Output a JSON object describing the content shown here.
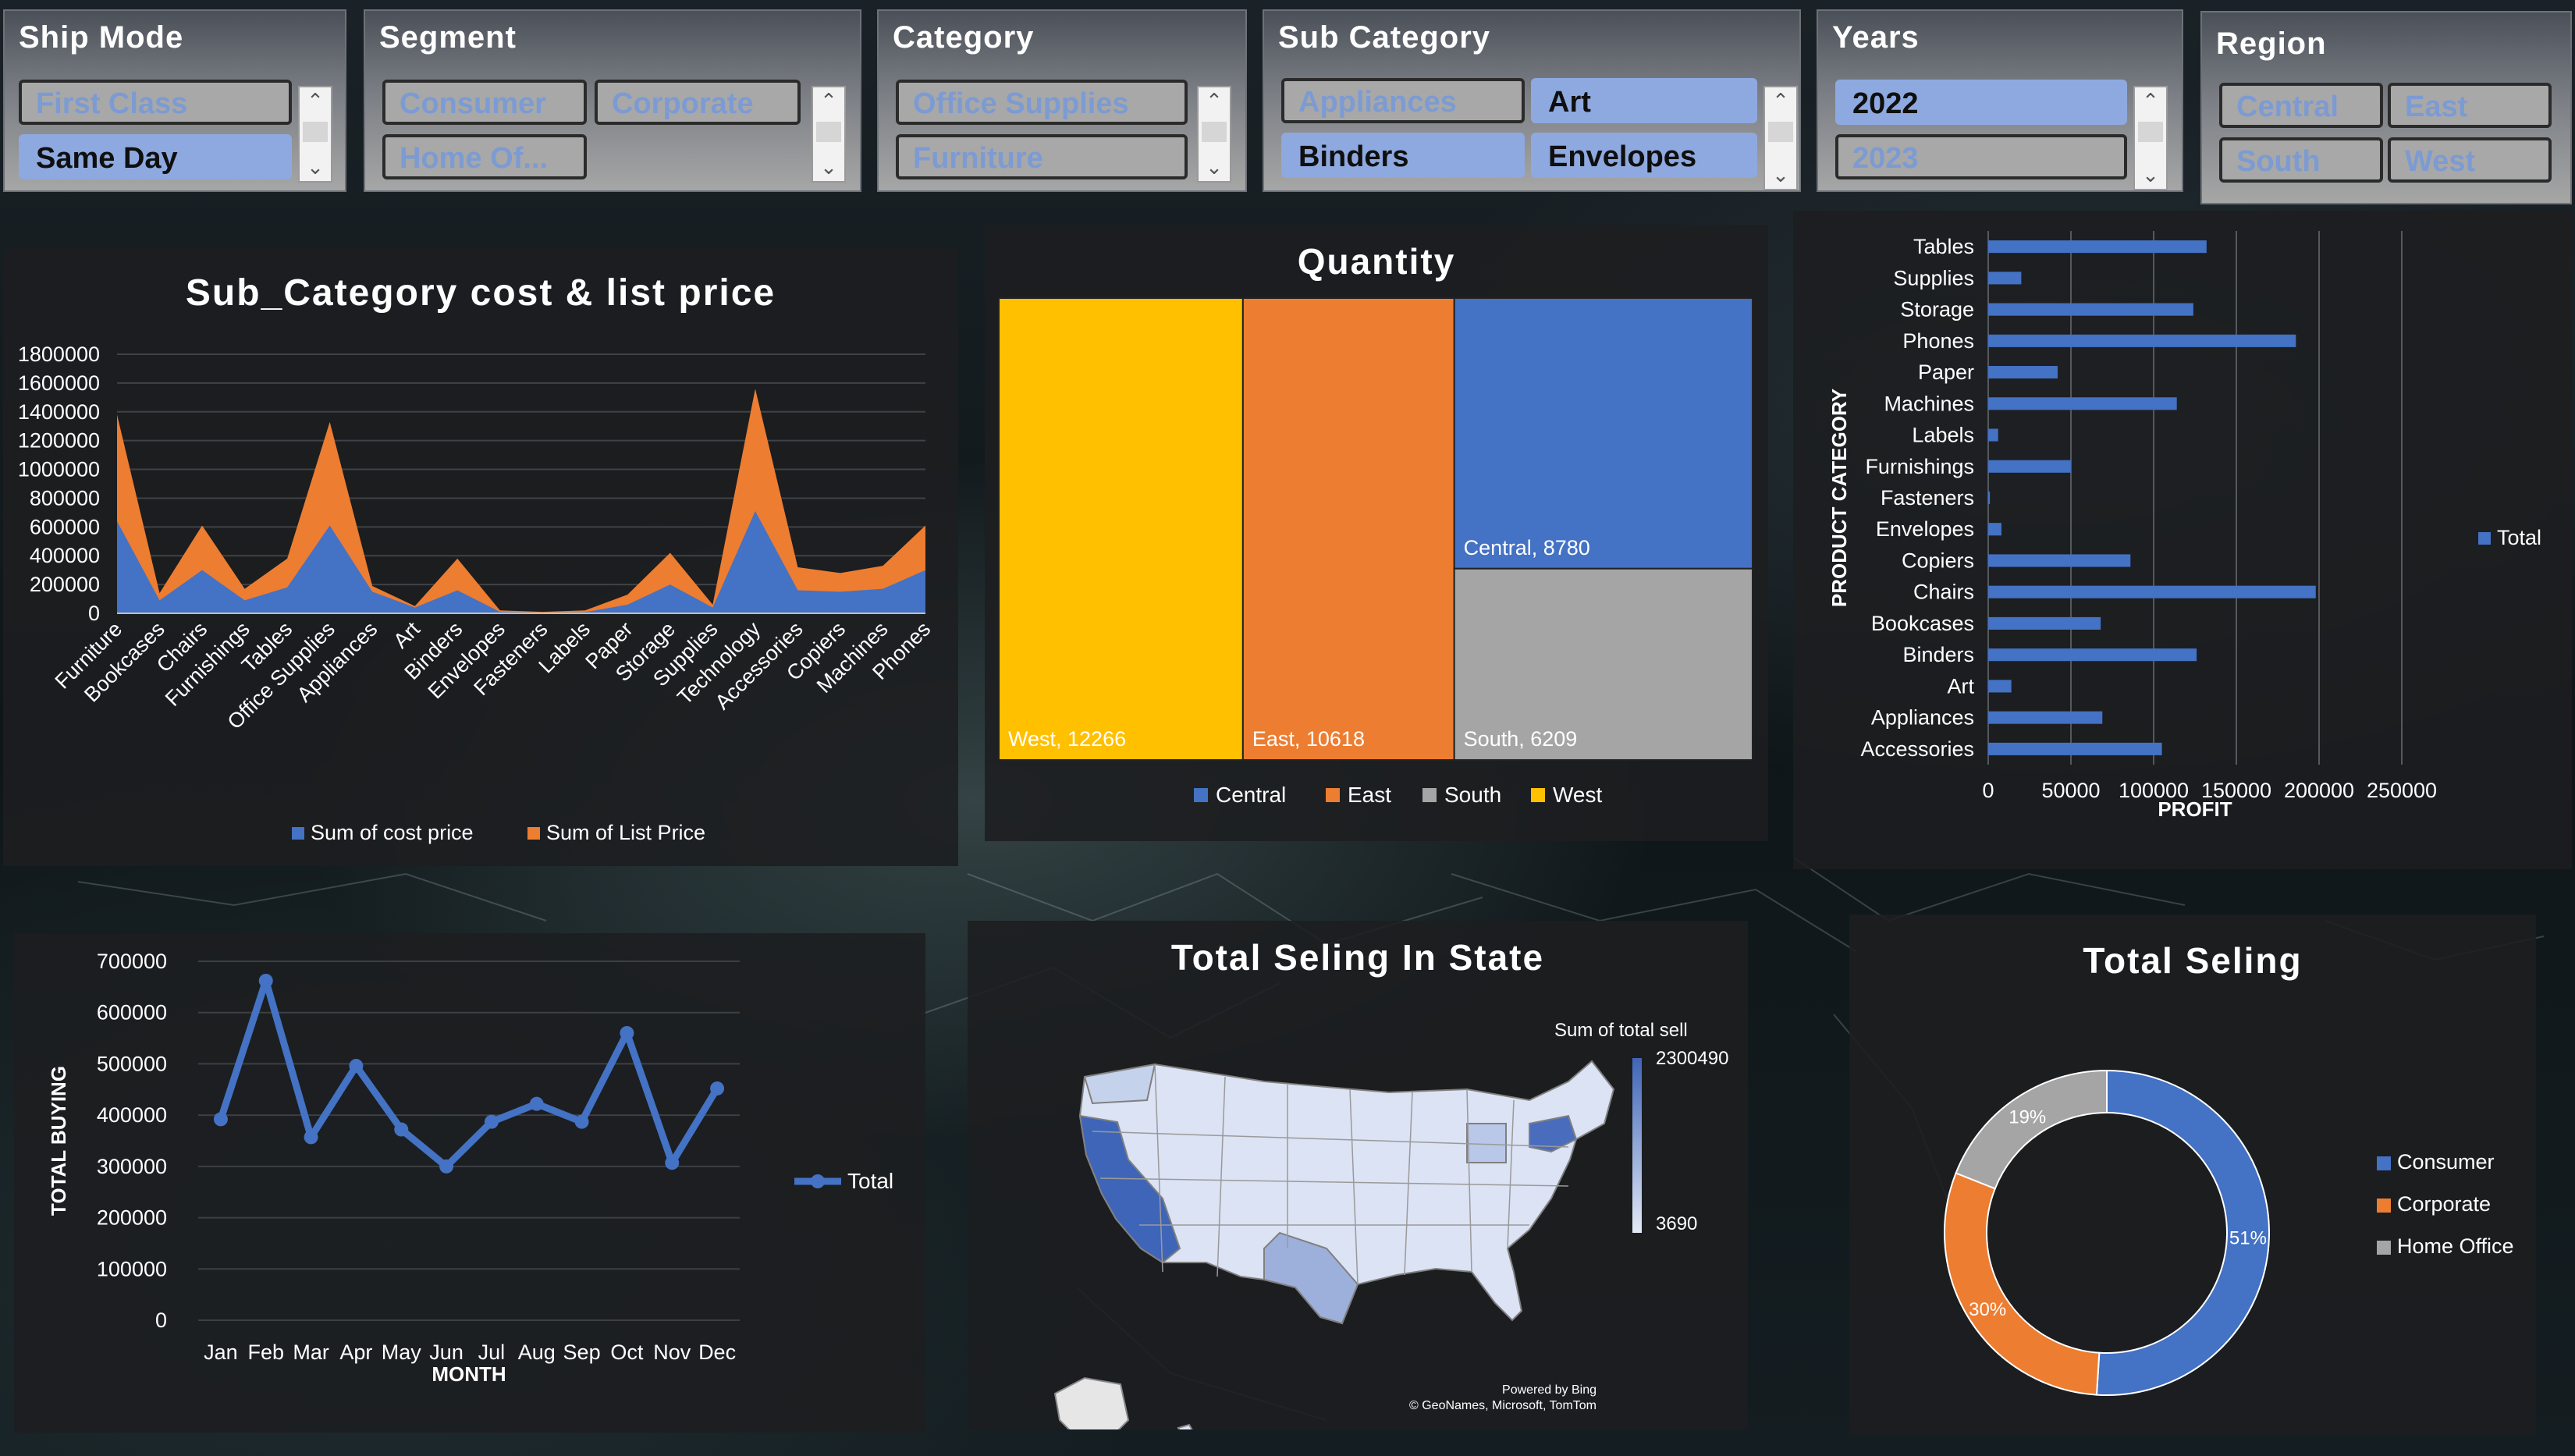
{
  "slicers": {
    "ship_mode": {
      "title": "Ship Mode",
      "items": [
        {
          "label": "First Class",
          "selected": false
        },
        {
          "label": "Same Day",
          "selected": true
        }
      ]
    },
    "segment": {
      "title": "Segment",
      "items": [
        {
          "label": "Consumer",
          "selected": false
        },
        {
          "label": "Corporate",
          "selected": false
        },
        {
          "label": "Home Of...",
          "selected": false
        }
      ]
    },
    "category": {
      "title": "Category",
      "items": [
        {
          "label": "Office Supplies",
          "selected": false
        },
        {
          "label": "Furniture",
          "selected": false
        }
      ]
    },
    "sub_category": {
      "title": "Sub Category",
      "items": [
        {
          "label": "Appliances",
          "selected": false
        },
        {
          "label": "Art",
          "selected": true
        },
        {
          "label": "Binders",
          "selected": true
        },
        {
          "label": "Envelopes",
          "selected": true
        }
      ]
    },
    "years": {
      "title": "Years",
      "items": [
        {
          "label": "2022",
          "selected": true
        },
        {
          "label": "2023",
          "selected": false
        }
      ]
    },
    "region": {
      "title": "Region",
      "items": [
        {
          "label": "Central",
          "selected": false
        },
        {
          "label": "East",
          "selected": false
        },
        {
          "label": "South",
          "selected": false
        },
        {
          "label": "West",
          "selected": false
        }
      ]
    }
  },
  "chart_data": [
    {
      "id": "cost_list",
      "type": "area",
      "title": "Sub_Category  cost  &  list  price",
      "categories": [
        "Furniture",
        "Bookcases",
        "Chairs",
        "Furnishings",
        "Tables",
        "Office Supplies",
        "Appliances",
        "Art",
        "Binders",
        "Envelopes",
        "Fasteners",
        "Labels",
        "Paper",
        "Storage",
        "Supplies",
        "Technology",
        "Accessories",
        "Copiers",
        "Machines",
        "Phones"
      ],
      "series": [
        {
          "name": "Sum of cost price",
          "color": "#4472c4",
          "values": [
            640000,
            90000,
            300000,
            90000,
            180000,
            610000,
            150000,
            40000,
            160000,
            10000,
            5000,
            8000,
            60000,
            200000,
            40000,
            710000,
            160000,
            150000,
            170000,
            300000
          ]
        },
        {
          "name": "Sum of List Price",
          "color": "#ed7d31",
          "values": [
            1380000,
            140000,
            610000,
            170000,
            380000,
            1330000,
            190000,
            50000,
            380000,
            20000,
            10000,
            20000,
            130000,
            420000,
            60000,
            1560000,
            320000,
            280000,
            330000,
            610000
          ]
        }
      ],
      "ylim": [
        0,
        1800000
      ],
      "yticks": [
        "1800000",
        "1600000",
        "1400000",
        "1200000",
        "1000000",
        "800000",
        "600000",
        "400000",
        "200000",
        "0"
      ],
      "legend": "bottom"
    },
    {
      "id": "quantity",
      "type": "treemap",
      "title": "Quantity",
      "items": [
        {
          "name": "West",
          "value": 12266,
          "label": "West, 12266",
          "color": "#ffc000"
        },
        {
          "name": "East",
          "value": 10618,
          "label": "East, 10618",
          "color": "#ed7d31"
        },
        {
          "name": "Central",
          "value": 8780,
          "label": "Central, 8780",
          "color": "#4472c4"
        },
        {
          "name": "South",
          "value": 6209,
          "label": "South, 6209",
          "color": "#a5a5a5"
        }
      ],
      "legend": [
        {
          "name": "Central",
          "color": "#4472c4"
        },
        {
          "name": "East",
          "color": "#ed7d31"
        },
        {
          "name": "South",
          "color": "#a5a5a5"
        },
        {
          "name": "West",
          "color": "#ffc000"
        }
      ]
    },
    {
      "id": "profit",
      "type": "bar",
      "orientation": "horizontal",
      "categories": [
        "Tables",
        "Supplies",
        "Storage",
        "Phones",
        "Paper",
        "Machines",
        "Labels",
        "Furnishings",
        "Fasteners",
        "Envelopes",
        "Copiers",
        "Chairs",
        "Bookcases",
        "Binders",
        "Art",
        "Appliances",
        "Accessories"
      ],
      "series": [
        {
          "name": "Total",
          "color": "#4472c4",
          "values": [
            132000,
            20000,
            124000,
            186000,
            42000,
            114000,
            6000,
            50000,
            1000,
            8000,
            86000,
            198000,
            68000,
            126000,
            14000,
            69000,
            105000
          ]
        }
      ],
      "xlim": [
        0,
        250000
      ],
      "xticks": [
        "0",
        "50000",
        "100000",
        "150000",
        "200000",
        "250000"
      ],
      "xlabel": "PROFIT",
      "ylabel": "PRODUCT CATEGORY",
      "legend": "right"
    },
    {
      "id": "buying",
      "type": "line",
      "categories": [
        "Jan",
        "Feb",
        "Mar",
        "Apr",
        "May",
        "Jun",
        "Jul",
        "Aug",
        "Sep",
        "Oct",
        "Nov",
        "Dec"
      ],
      "series": [
        {
          "name": "Total",
          "color": "#4472c4",
          "values": [
            392000,
            662000,
            357000,
            496000,
            372000,
            300000,
            387000,
            422000,
            387000,
            560000,
            307000,
            452000
          ]
        }
      ],
      "ylim": [
        0,
        700000
      ],
      "yticks": [
        "700000",
        "600000",
        "500000",
        "400000",
        "300000",
        "200000",
        "100000",
        "0"
      ],
      "xlabel": "MONTH",
      "ylabel": "TOTAL BUYING",
      "legend": "right"
    },
    {
      "id": "state_map",
      "type": "map",
      "title": "Total  Seling  In  State",
      "legend_title": "Sum of total sell",
      "max_label": "2300490",
      "min_label": "3690",
      "attribution": [
        "Powered by Bing",
        "© GeoNames, Microsoft, TomTom"
      ]
    },
    {
      "id": "segment_donut",
      "type": "pie",
      "title": "Total  Seling",
      "slices": [
        {
          "name": "Consumer",
          "value": 51,
          "label": "51%",
          "color": "#4472c4"
        },
        {
          "name": "Corporate",
          "value": 30,
          "label": "30%",
          "color": "#ed7d31"
        },
        {
          "name": "Home Office",
          "value": 19,
          "label": "19%",
          "color": "#a5a5a5"
        }
      ],
      "legend": "right"
    }
  ]
}
